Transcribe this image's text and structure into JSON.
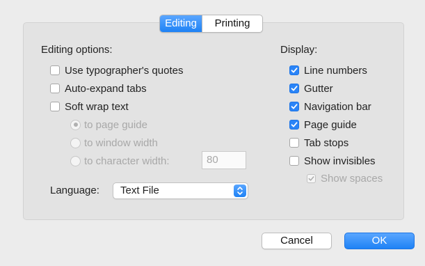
{
  "tabs": [
    {
      "label": "Editing",
      "active": true
    },
    {
      "label": "Printing",
      "active": false
    }
  ],
  "editing": {
    "heading": "Editing options:",
    "options": [
      {
        "label": "Use typographer's quotes",
        "checked": false
      },
      {
        "label": "Auto-expand tabs",
        "checked": false
      },
      {
        "label": "Soft wrap text",
        "checked": false
      }
    ],
    "wrap_modes": [
      {
        "label": "to page guide",
        "selected": true
      },
      {
        "label": "to window width",
        "selected": false
      },
      {
        "label": "to character width:",
        "selected": false
      }
    ],
    "char_width_value": "80",
    "language_label": "Language:",
    "language_value": "Text File"
  },
  "display": {
    "heading": "Display:",
    "options": [
      {
        "label": "Line numbers",
        "checked": true
      },
      {
        "label": "Gutter",
        "checked": true
      },
      {
        "label": "Navigation bar",
        "checked": true
      },
      {
        "label": "Page guide",
        "checked": true
      },
      {
        "label": "Tab stops",
        "checked": false
      },
      {
        "label": "Show invisibles",
        "checked": false
      }
    ],
    "sub_option": {
      "label": "Show spaces",
      "checked": true
    }
  },
  "buttons": {
    "cancel": "Cancel",
    "ok": "OK"
  },
  "colors": {
    "accent": "#1e82f5",
    "background": "#ececec",
    "panel": "#e3e3e3"
  }
}
